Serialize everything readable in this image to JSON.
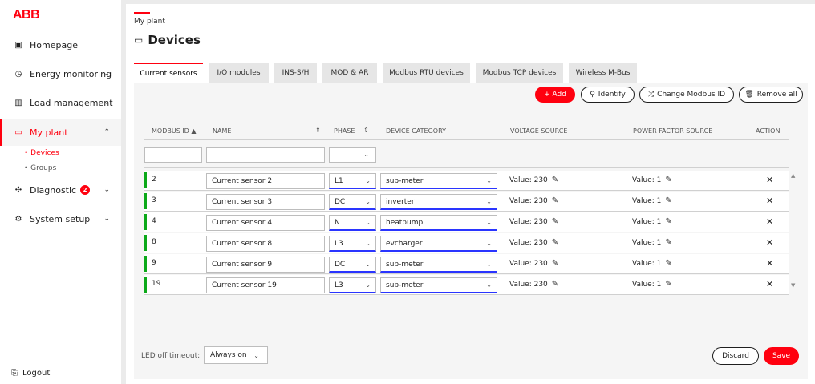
{
  "app": {
    "logo": "ABB"
  },
  "sidebar": {
    "items": [
      {
        "label": "Homepage",
        "icon": "▣"
      },
      {
        "label": "Energy monitoring",
        "icon": "◷"
      },
      {
        "label": "Load management",
        "icon": "▥"
      },
      {
        "label": "My plant",
        "icon": "▭"
      },
      {
        "label": "Diagnostic",
        "icon": "✣",
        "badge": "2"
      },
      {
        "label": "System setup",
        "icon": "⚙"
      }
    ],
    "sub": [
      "• Devices",
      "• Groups"
    ],
    "logout": "Logout"
  },
  "breadcrumb": "My plant",
  "title": "Devices",
  "tabs": [
    "Current sensors",
    "I/O modules",
    "INS-S/H",
    "MOD & AR",
    "Modbus RTU devices",
    "Modbus TCP devices",
    "Wireless M-Bus"
  ],
  "actions": {
    "add": "+ Add",
    "identify": "Identify",
    "change": "Change Modbus ID",
    "remove": "Remove all"
  },
  "columns": [
    "MODBUS ID",
    "NAME",
    "PHASE",
    "DEVICE CATEGORY",
    "VOLTAGE SOURCE",
    "POWER FACTOR SOURCE",
    "ACTION"
  ],
  "rows": [
    {
      "id": "2",
      "name": "Current sensor 2",
      "phase": "L1",
      "category": "sub-meter",
      "voltage": "Value: 230",
      "pf": "Value: 1"
    },
    {
      "id": "3",
      "name": "Current sensor 3",
      "phase": "DC",
      "category": "inverter",
      "voltage": "Value: 230",
      "pf": "Value: 1"
    },
    {
      "id": "4",
      "name": "Current sensor 4",
      "phase": "N",
      "category": "heatpump",
      "voltage": "Value: 230",
      "pf": "Value: 1"
    },
    {
      "id": "8",
      "name": "Current sensor 8",
      "phase": "L3",
      "category": "evcharger",
      "voltage": "Value: 230",
      "pf": "Value: 1"
    },
    {
      "id": "9",
      "name": "Current sensor 9",
      "phase": "DC",
      "category": "sub-meter",
      "voltage": "Value: 230",
      "pf": "Value: 1"
    },
    {
      "id": "19",
      "name": "Current sensor 19",
      "phase": "L3",
      "category": "sub-meter",
      "voltage": "Value: 230",
      "pf": "Value: 1"
    }
  ],
  "footer": {
    "led_label": "LED off timeout:",
    "led_value": "Always on",
    "discard": "Discard",
    "save": "Save"
  },
  "colors": {
    "accent": "#ff000f",
    "active_marker": "#0ca919",
    "select_underline": "#2a35ff"
  }
}
